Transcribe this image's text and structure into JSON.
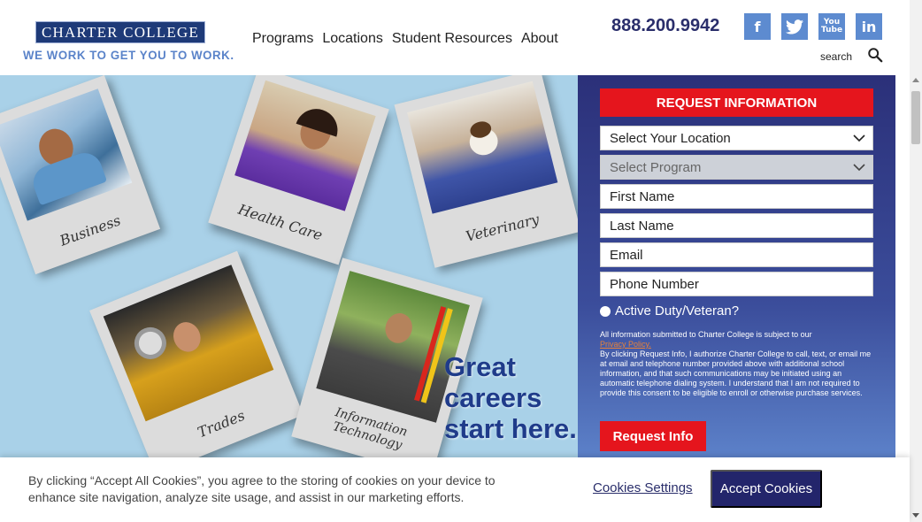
{
  "header": {
    "logo_text": "CHARTER COLLEGE",
    "tagline": "WE WORK TO GET YOU TO WORK.",
    "nav": [
      {
        "label": "Programs"
      },
      {
        "label": "Locations"
      },
      {
        "label": "Student Resources"
      },
      {
        "label": "About"
      }
    ],
    "phone": "888.200.9942",
    "socials": [
      {
        "icon": "facebook-icon",
        "glyph": "f"
      },
      {
        "icon": "twitter-icon",
        "glyph": "t"
      },
      {
        "icon": "youtube-icon",
        "glyph": "You\nTube"
      },
      {
        "icon": "linkedin-icon",
        "glyph": "in"
      }
    ],
    "search_label": "search"
  },
  "hero": {
    "photos": [
      {
        "caption": "Business"
      },
      {
        "caption": "Health Care"
      },
      {
        "caption": "Veterinary"
      },
      {
        "caption": "Trades"
      },
      {
        "caption": "Information Technology"
      }
    ],
    "slogan_lines": [
      "Great",
      "careers",
      "start here."
    ]
  },
  "form": {
    "title": "REQUEST INFORMATION",
    "location_placeholder": "Select Your Location",
    "program_placeholder": "Select Program",
    "first_name": "First Name",
    "last_name": "Last Name",
    "email": "Email",
    "phone": "Phone Number",
    "veteran_label": "Active Duty/Veteran?",
    "legal_intro": "All information submitted to Charter College is subject to our",
    "privacy_link": "Privacy Policy.",
    "legal_body": "By clicking Request Info, I authorize Charter College to call, text, or email me at email and telephone number provided above with additional school information, and that such communications may be initiated using an automatic telephone dialing system. I understand that I am not required to provide this consent to be eligible to enroll or otherwise purchase services.",
    "submit_label": "Request Info"
  },
  "cookie": {
    "text": "By clicking “Accept All Cookies”, you agree to the storing of cookies on your device to enhance site navigation, analyze site usage, and assist in our marketing efforts.",
    "settings_label": "Cookies Settings",
    "accept_label": "Accept Cookies"
  },
  "colors": {
    "brand_navy": "#2a2e6b",
    "accent_red": "#e5151d",
    "social_blue": "#5d8bd0",
    "hero_sky": "#a9d1e8"
  }
}
